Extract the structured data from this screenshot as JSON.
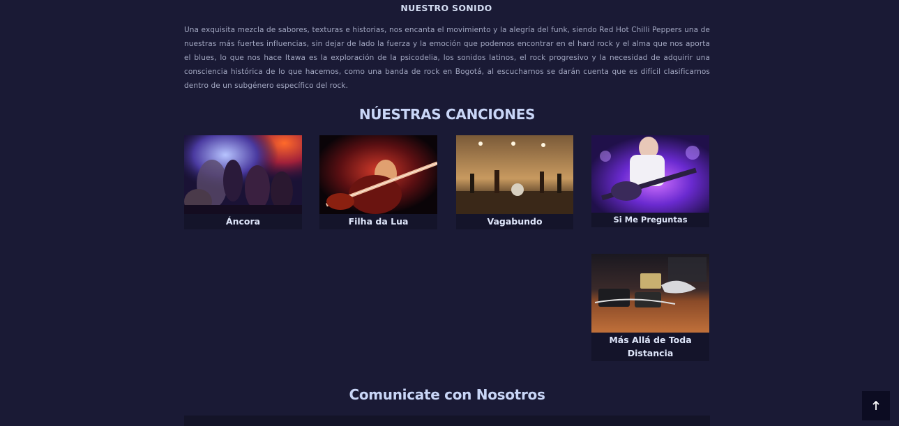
{
  "sound": {
    "title": "NUESTRO SONIDO",
    "text": "Una exquisita mezcla de sabores, texturas e historias, nos encanta el movimiento y la alegría del funk, siendo Red Hot Chilli Peppers una de nuestras más fuertes influencias, sin dejar de lado la fuerza y la emoción que podemos encontrar en el hard rock y el alma que nos aporta el blues, lo que nos hace Itawa es la exploración de la psicodelia, los sonidos latinos, el rock progresivo y la necesidad de adquirir una consciencia histórica de lo que hacemos, como una banda de rock en Bogotá, al escucharnos se darán cuenta que es difícil clasificarnos dentro de un subgénero específico del rock."
  },
  "songs": {
    "title": "NÚESTRAS CANCIONES",
    "items": [
      {
        "title": "Áncora",
        "image": "band-live-concert-photo"
      },
      {
        "title": "Filha da Lua",
        "image": "guitarist-closeup-photo"
      },
      {
        "title": "Vagabundo",
        "image": "band-stage-wide-photo"
      },
      {
        "title": "Si Me Preguntas",
        "image": "guitarist-purple-light-photo"
      },
      {
        "title": "Más Allá de Toda Distancia",
        "image": "guitar-pedals-photo"
      }
    ]
  },
  "contact": {
    "title": "Comunicate con Nosotros"
  },
  "scroll_top": {
    "icon": "arrow-up-icon"
  }
}
